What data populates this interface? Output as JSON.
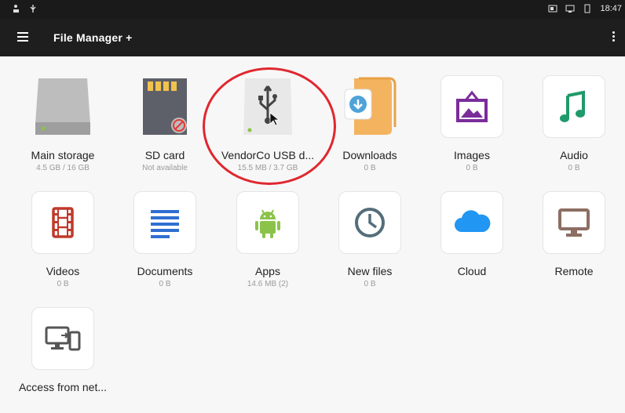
{
  "status_bar": {
    "time": "18:47"
  },
  "toolbar": {
    "title": "File Manager +"
  },
  "tiles": [
    {
      "label": "Main storage",
      "sub": "4.5 GB / 16 GB"
    },
    {
      "label": "SD card",
      "sub": "Not available"
    },
    {
      "label": "VendorCo USB d...",
      "sub": "15.5 MB / 3.7 GB"
    },
    {
      "label": "Downloads",
      "sub": "0 B"
    },
    {
      "label": "Images",
      "sub": "0 B"
    },
    {
      "label": "Audio",
      "sub": "0 B"
    },
    {
      "label": "Videos",
      "sub": "0 B"
    },
    {
      "label": "Documents",
      "sub": "0 B"
    },
    {
      "label": "Apps",
      "sub": "14.6 MB (2)"
    },
    {
      "label": "New files",
      "sub": "0 B"
    },
    {
      "label": "Cloud",
      "sub": ""
    },
    {
      "label": "Remote",
      "sub": ""
    },
    {
      "label": "Access from net...",
      "sub": ""
    }
  ],
  "colors": {
    "highlight": "#e0272f",
    "images_purple": "#7b2c9b",
    "audio_green": "#1f9a6a",
    "videos_red": "#c0392b",
    "documents_blue": "#2f6fd1",
    "apps_green": "#8bc34a",
    "cloud_blue": "#2196f3",
    "remote_brown": "#8d6e63",
    "network_gray": "#555555"
  }
}
